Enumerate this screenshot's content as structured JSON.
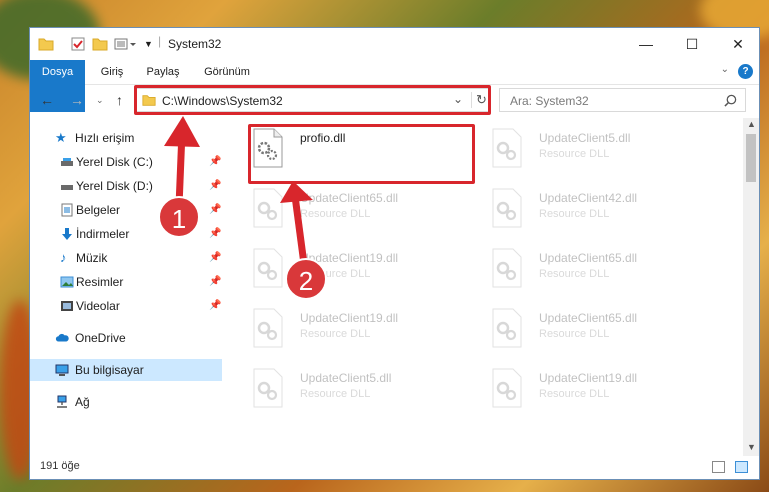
{
  "window": {
    "title": "System32"
  },
  "ribbon": {
    "tabs": [
      "Dosya",
      "Giriş",
      "Paylaş",
      "Görünüm"
    ]
  },
  "address": {
    "path": "C:\\Windows\\System32"
  },
  "search": {
    "placeholder": "Ara: System32"
  },
  "sidebar": {
    "items": [
      {
        "label": "Hızlı erişim",
        "icon": "star-icon",
        "pinned": false
      },
      {
        "label": "Yerel Disk (C:)",
        "icon": "drive-icon",
        "pinned": true
      },
      {
        "label": "Yerel Disk (D:)",
        "icon": "drive-icon",
        "pinned": true
      },
      {
        "label": "Belgeler",
        "icon": "documents-icon",
        "pinned": true
      },
      {
        "label": "İndirmeler",
        "icon": "download-icon",
        "pinned": true
      },
      {
        "label": "Müzik",
        "icon": "music-icon",
        "pinned": true
      },
      {
        "label": "Resimler",
        "icon": "pictures-icon",
        "pinned": true
      },
      {
        "label": "Videolar",
        "icon": "videos-icon",
        "pinned": true
      },
      {
        "label": "OneDrive",
        "icon": "cloud-icon"
      },
      {
        "label": "Bu bilgisayar",
        "icon": "computer-icon",
        "selected": true
      },
      {
        "label": "Ağ",
        "icon": "network-icon"
      }
    ]
  },
  "files": [
    {
      "name": "profio.dll",
      "type": ""
    },
    {
      "name": "UpdateClient5.dll",
      "type": "Resource DLL"
    },
    {
      "name": "UpdateClient65.dll",
      "type": "Resource DLL"
    },
    {
      "name": "UpdateClient42.dll",
      "type": "Resource DLL"
    },
    {
      "name": "UpdateClient19.dll",
      "type": "Resource DLL"
    },
    {
      "name": "UpdateClient65.dll",
      "type": "Resource DLL"
    },
    {
      "name": "UpdateClient19.dll",
      "type": "Resource DLL"
    },
    {
      "name": "UpdateClient65.dll",
      "type": "Resource DLL"
    },
    {
      "name": "UpdateClient5.dll",
      "type": "Resource DLL"
    },
    {
      "name": "UpdateClient19.dll",
      "type": "Resource DLL"
    }
  ],
  "status": {
    "count": "191 öğe"
  },
  "callouts": {
    "first": "1",
    "second": "2"
  },
  "colors": {
    "accent": "#1979ca",
    "highlight": "#d8262c",
    "selected": "#cce8ff"
  }
}
